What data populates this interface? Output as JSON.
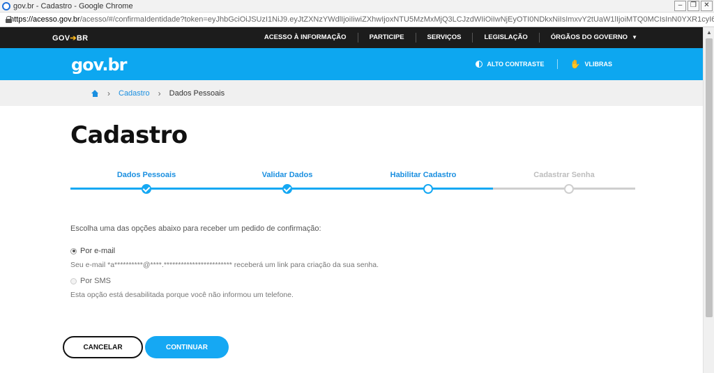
{
  "window": {
    "title": "gov.br - Cadastro - Google Chrome",
    "url_host": "https://acesso.gov.br",
    "url_rest": "/acesso/#/confirmaIdentidade?token=eyJhbGciOiJSUzI1NiJ9.eyJtZXNzYWdlIjoiIiwiZXhwIjoxNTU5MzMxMjQ3LCJzdWIiOiIwNjEyOTI0NDkxNiIsImxvY2tUaW1lIjoiMTQ0MCIsInN0YXR1cyI6IlZBTEl..."
  },
  "govbar": {
    "brand": "GOV",
    "brand_suffix": "BR",
    "nav": [
      "ACESSO À INFORMAÇÃO",
      "PARTICIPE",
      "SERVIÇOS",
      "LEGISLAÇÃO",
      "ÓRGÃOS DO GOVERNO"
    ]
  },
  "header": {
    "logo": "gov.br",
    "high_contrast": "ALTO CONTRASTE",
    "vlibras": "VLIBRAS"
  },
  "breadcrumb": {
    "link": "Cadastro",
    "current": "Dados Pessoais"
  },
  "page": {
    "title": "Cadastro"
  },
  "stepper": {
    "steps": [
      {
        "label": "Dados Pessoais",
        "state": "done"
      },
      {
        "label": "Validar Dados",
        "state": "done"
      },
      {
        "label": "Habilitar Cadastro",
        "state": "current"
      },
      {
        "label": "Cadastrar Senha",
        "state": "pending"
      }
    ]
  },
  "form": {
    "instruction": "Escolha uma das opções abaixo para receber um pedido de confirmação:",
    "email_option": "Por e-mail",
    "email_desc": "Seu e-mail *a**********@****.************************ receberá um link para criação da sua senha.",
    "sms_option": "Por SMS",
    "sms_desc": "Esta opção está desabilitada porque você não informou um telefone.",
    "selected": "email"
  },
  "actions": {
    "cancel": "CANCELAR",
    "continue": "CONTINUAR"
  },
  "colors": {
    "primary": "#15a8f3",
    "link": "#1a8fe0",
    "topbar": "#1c1c1c"
  }
}
